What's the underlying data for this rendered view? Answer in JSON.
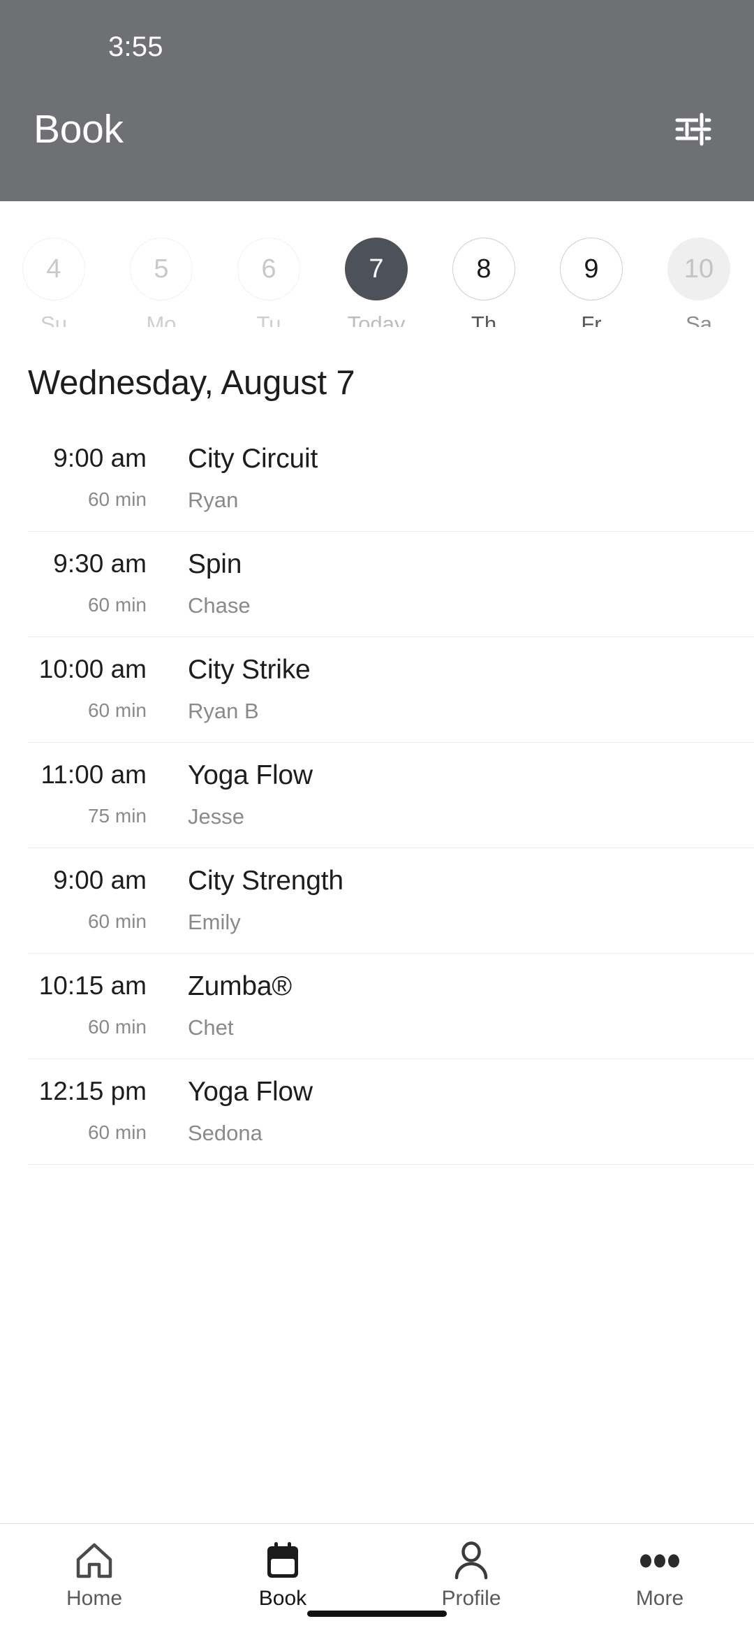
{
  "status_bar": {
    "time": "3:55"
  },
  "header": {
    "title": "Book",
    "filter_icon": "filter-sliders-icon",
    "background_color": "#6e7073",
    "text_color": "#ffffff"
  },
  "date_strip": {
    "days": [
      {
        "number": "4",
        "label": "Su",
        "state": "past"
      },
      {
        "number": "5",
        "label": "Mo",
        "state": "past"
      },
      {
        "number": "6",
        "label": "Tu",
        "state": "past"
      },
      {
        "number": "7",
        "label": "Today",
        "state": "today"
      },
      {
        "number": "8",
        "label": "Th",
        "state": "future"
      },
      {
        "number": "9",
        "label": "Fr",
        "state": "future"
      },
      {
        "number": "10",
        "label": "Sa",
        "state": "disabled"
      }
    ],
    "selected_color": "#4c515a"
  },
  "day_heading": "Wednesday, August 7",
  "classes": [
    {
      "time": "9:00 am",
      "duration": "60 min",
      "name": "City Circuit",
      "instructor": "Ryan"
    },
    {
      "time": "9:30 am",
      "duration": "60 min",
      "name": "Spin",
      "instructor": "Chase"
    },
    {
      "time": "10:00 am",
      "duration": "60 min",
      "name": "City Strike",
      "instructor": "Ryan B"
    },
    {
      "time": "11:00 am",
      "duration": "75 min",
      "name": "Yoga Flow",
      "instructor": "Jesse"
    },
    {
      "time": "9:00 am",
      "duration": "60 min",
      "name": "City Strength",
      "instructor": "Emily"
    },
    {
      "time": "10:15 am",
      "duration": "60 min",
      "name": "Zumba®",
      "instructor": "Chet"
    },
    {
      "time": "12:15 pm",
      "duration": "60 min",
      "name": "Yoga Flow",
      "instructor": "Sedona"
    }
  ],
  "bottom_nav": {
    "items": [
      {
        "label": "Home",
        "icon": "home-icon",
        "active": false
      },
      {
        "label": "Book",
        "icon": "calendar-icon",
        "active": true
      },
      {
        "label": "Profile",
        "icon": "person-icon",
        "active": false
      },
      {
        "label": "More",
        "icon": "ellipsis-icon",
        "active": false
      }
    ]
  }
}
